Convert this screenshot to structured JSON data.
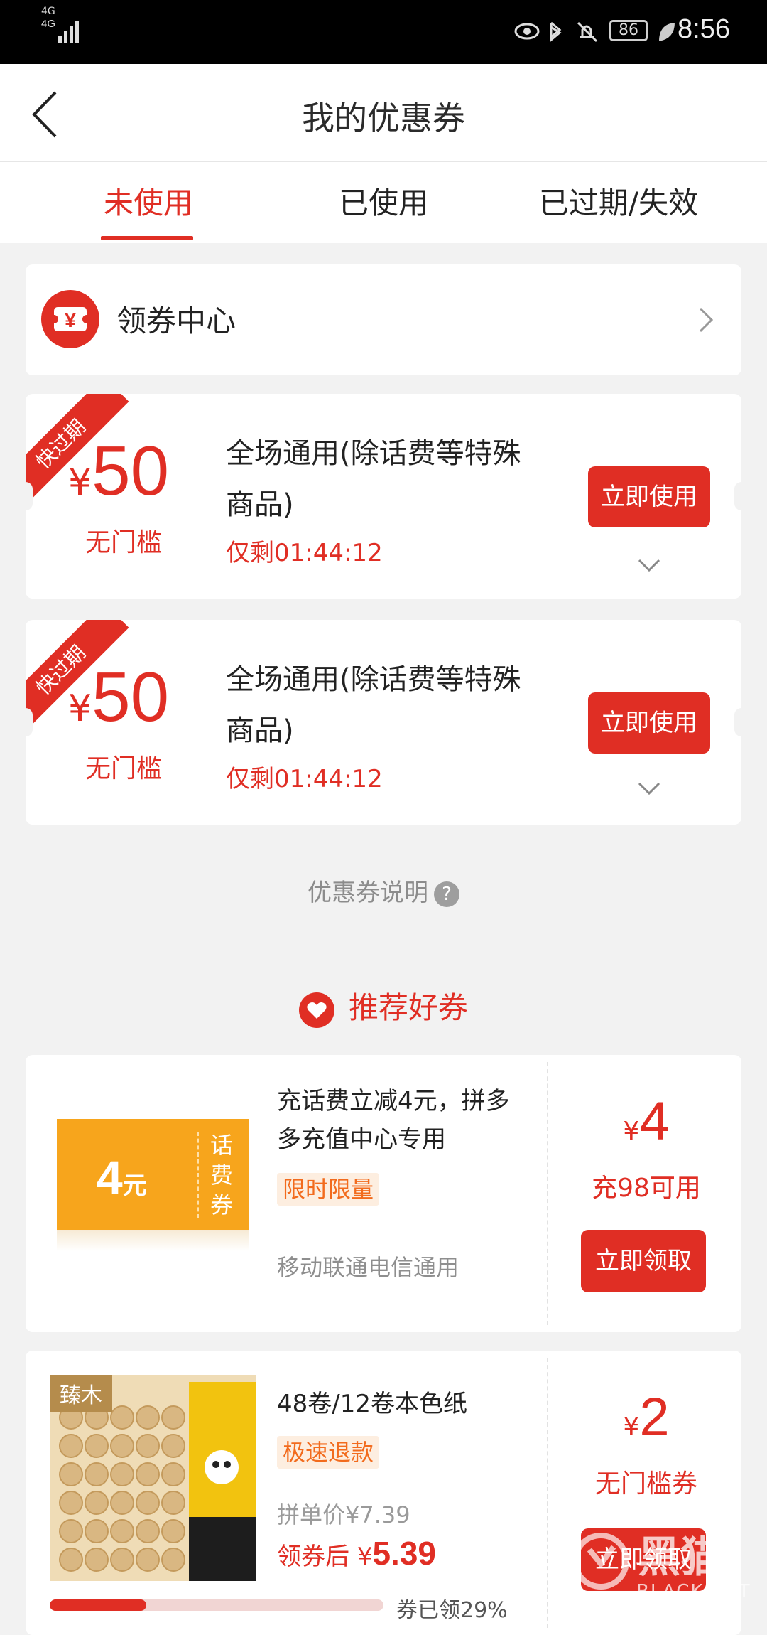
{
  "status_bar": {
    "network": "4G",
    "battery": "86",
    "time": "8:56"
  },
  "header": {
    "title": "我的优惠券"
  },
  "tabs": [
    {
      "label": "未使用",
      "active": true
    },
    {
      "label": "已使用",
      "active": false
    },
    {
      "label": "已过期/失效",
      "active": false
    }
  ],
  "coupon_center": {
    "label": "领券中心",
    "icon_text": "¥"
  },
  "coupons": [
    {
      "ribbon": "快过期",
      "currency": "¥",
      "amount": "50",
      "threshold": "无门槛",
      "description": "全场通用(除话费等特殊商品)",
      "countdown": "仅剩01:44:12",
      "button": "立即使用"
    },
    {
      "ribbon": "快过期",
      "currency": "¥",
      "amount": "50",
      "threshold": "无门槛",
      "description": "全场通用(除话费等特殊商品)",
      "countdown": "仅剩01:44:12",
      "button": "立即使用"
    }
  ],
  "explanation": {
    "label": "优惠券说明",
    "icon": "?"
  },
  "recommend": {
    "title": "推荐好券",
    "cards": [
      {
        "coupon_amount": "4",
        "coupon_unit": "元",
        "coupon_side": "话费券",
        "title": "充话费立减4元，拼多多充值中心专用",
        "tag": "限时限量",
        "subtitle": "移动联通电信通用",
        "currency": "¥",
        "amount": "4",
        "condition": "充98可用",
        "button": "立即领取"
      },
      {
        "brand": "臻木",
        "title": "48卷/12卷本色纸",
        "tag": "极速退款",
        "price_label": "拼单价¥7.39",
        "after_label": "领券后",
        "after_currency": "¥",
        "after_price": "5.39",
        "progress": 0.29,
        "progress_text": "券已领29%",
        "currency": "¥",
        "amount": "2",
        "condition": "无门槛券",
        "button": "立即领取"
      }
    ]
  },
  "watermark": {
    "text_cn": "黑猫",
    "text_en": "BLACK CAT"
  },
  "colors": {
    "accent": "#e02e24",
    "orange": "#f7a51c",
    "background": "#f2f2f2"
  }
}
